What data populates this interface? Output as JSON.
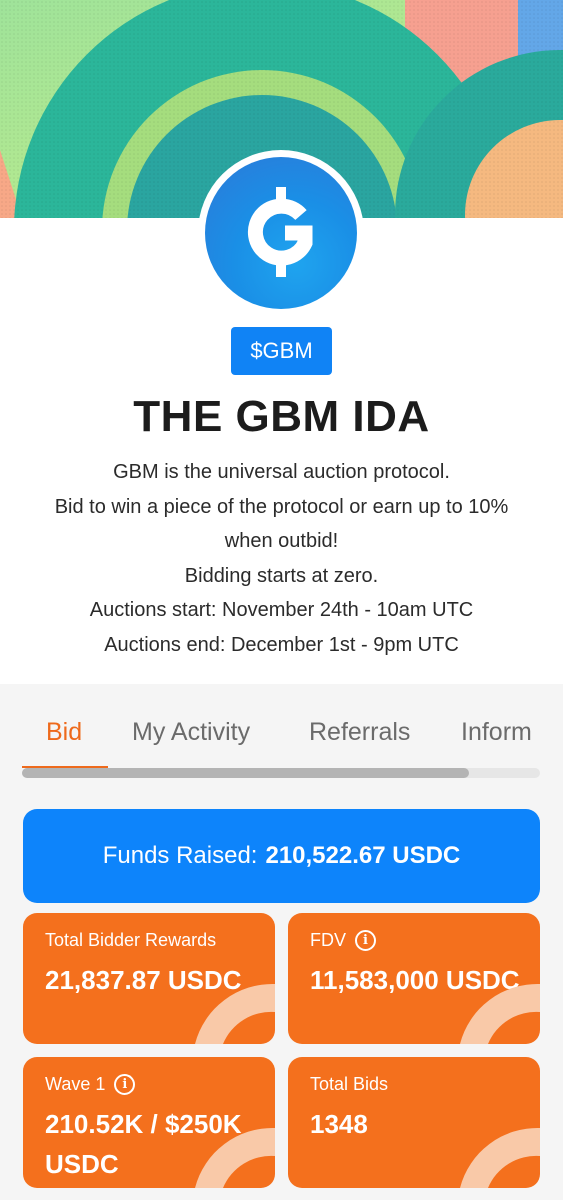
{
  "colors": {
    "brand_blue": "#0d84fb",
    "accent_orange": "#f4701d",
    "tab_active": "#ee6a1c"
  },
  "header": {
    "logo_icon": "gbm-logo-icon",
    "ticker": "$GBM",
    "title": "THE GBM IDA",
    "description_lines": [
      "GBM is the universal auction protocol.",
      "Bid to win a piece of the protocol or earn up to 10%",
      "when outbid!",
      "Bidding starts at zero.",
      "Auctions start: November 24th - 10am UTC",
      "Auctions end: December 1st - 9pm UTC"
    ]
  },
  "tabs": [
    {
      "label": "Bid",
      "active": true
    },
    {
      "label": "My Activity",
      "active": false
    },
    {
      "label": "Referrals",
      "active": false
    },
    {
      "label": "Inform",
      "active": false
    }
  ],
  "funds": {
    "label": "Funds Raised:",
    "value": "210,522.67 USDC"
  },
  "stats": {
    "total_bidder_rewards": {
      "label": "Total Bidder Rewards",
      "value": "21,837.87 USDC"
    },
    "fdv": {
      "label": "FDV",
      "value": "11,583,000 USDC",
      "info_icon": "info-icon"
    },
    "wave": {
      "label": "Wave 1",
      "value": "210.52K / $250K USDC",
      "info_icon": "info-icon"
    },
    "total_bids": {
      "label": "Total Bids",
      "value": "1348"
    }
  }
}
